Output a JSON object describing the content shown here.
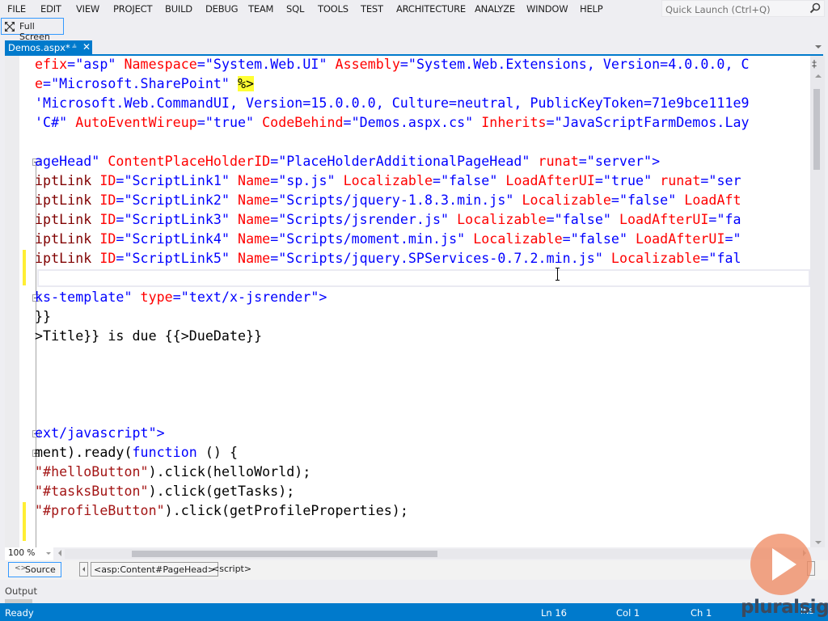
{
  "menubar": {
    "items": [
      "FILE",
      "EDIT",
      "VIEW",
      "PROJECT",
      "BUILD",
      "DEBUG",
      "TEAM",
      "SQL",
      "TOOLS",
      "TEST",
      "ARCHITECTURE",
      "ANALYZE",
      "WINDOW",
      "HELP"
    ],
    "quick_launch_placeholder": "Quick Launch (Ctrl+Q)",
    "search_icon": "search-icon"
  },
  "toolbar": {
    "full_screen_label": "Full Screen",
    "full_screen_icon": "fullscreen-icon"
  },
  "tabs": [
    {
      "label": "Demos.aspx*",
      "active": true,
      "pin_icon": "pin-icon",
      "close_icon": "close-icon"
    }
  ],
  "editor": {
    "current_line_number": 16,
    "lines": [
      [
        [
          "t-red",
          "efix"
        ],
        [
          "t-blue",
          "=\"asp\" "
        ],
        [
          "t-red",
          "Namespace"
        ],
        [
          "t-blue",
          "=\"System.Web.UI\" "
        ],
        [
          "t-red",
          "Assembly"
        ],
        [
          "t-blue",
          "=\"System.Web.Extensions, Version=4.0.0.0, C"
        ]
      ],
      [
        [
          "t-red",
          "e"
        ],
        [
          "t-blue",
          "=\"Microsoft.SharePoint\" "
        ],
        [
          "t-hl",
          "%>"
        ]
      ],
      [
        [
          "t-blue",
          "'Microsoft.Web.CommandUI, Version=15.0.0.0, Culture=neutral, PublicKeyToken=71e9bce111e9"
        ]
      ],
      [
        [
          "t-blue",
          "'C#\" "
        ],
        [
          "t-red",
          "AutoEventWireup"
        ],
        [
          "t-blue",
          "=\"true\" "
        ],
        [
          "t-red",
          "CodeBehind"
        ],
        [
          "t-blue",
          "=\"Demos.aspx.cs\" "
        ],
        [
          "t-red",
          "Inherits"
        ],
        [
          "t-blue",
          "=\"JavaScriptFarmDemos.Lay"
        ]
      ],
      [],
      [
        [
          "t-blue",
          "ageHead\" "
        ],
        [
          "t-red",
          "ContentPlaceHolderID"
        ],
        [
          "t-blue",
          "=\"PlaceHolderAdditionalPageHead\" "
        ],
        [
          "t-red",
          "runat"
        ],
        [
          "t-blue",
          "=\"server\">"
        ]
      ],
      [
        [
          "t-dark",
          "iptLink "
        ],
        [
          "t-red",
          "ID"
        ],
        [
          "t-blue",
          "=\"ScriptLink1\" "
        ],
        [
          "t-red",
          "Name"
        ],
        [
          "t-blue",
          "=\"sp.js\" "
        ],
        [
          "t-red",
          "Localizable"
        ],
        [
          "t-blue",
          "=\"false\" "
        ],
        [
          "t-red",
          "LoadAfterUI"
        ],
        [
          "t-blue",
          "=\"true\" "
        ],
        [
          "t-red",
          "runat"
        ],
        [
          "t-blue",
          "=\"ser"
        ]
      ],
      [
        [
          "t-dark",
          "iptLink "
        ],
        [
          "t-red",
          "ID"
        ],
        [
          "t-blue",
          "=\"ScriptLink2\" "
        ],
        [
          "t-red",
          "Name"
        ],
        [
          "t-blue",
          "=\"Scripts/jquery-1.8.3.min.js\" "
        ],
        [
          "t-red",
          "Localizable"
        ],
        [
          "t-blue",
          "=\"false\" "
        ],
        [
          "t-red",
          "LoadAft"
        ]
      ],
      [
        [
          "t-dark",
          "iptLink "
        ],
        [
          "t-red",
          "ID"
        ],
        [
          "t-blue",
          "=\"ScriptLink3\" "
        ],
        [
          "t-red",
          "Name"
        ],
        [
          "t-blue",
          "=\"Scripts/jsrender.js\" "
        ],
        [
          "t-red",
          "Localizable"
        ],
        [
          "t-blue",
          "=\"false\" "
        ],
        [
          "t-red",
          "LoadAfterUI"
        ],
        [
          "t-blue",
          "=\"fa"
        ]
      ],
      [
        [
          "t-dark",
          "iptLink "
        ],
        [
          "t-red",
          "ID"
        ],
        [
          "t-blue",
          "=\"ScriptLink4\" "
        ],
        [
          "t-red",
          "Name"
        ],
        [
          "t-blue",
          "=\"Scripts/moment.min.js\" "
        ],
        [
          "t-red",
          "Localizable"
        ],
        [
          "t-blue",
          "=\"false\" "
        ],
        [
          "t-red",
          "LoadAfterUI"
        ],
        [
          "t-blue",
          "=\""
        ]
      ],
      [
        [
          "t-dark",
          "iptLink "
        ],
        [
          "t-red",
          "ID"
        ],
        [
          "t-blue",
          "=\"ScriptLink5\" "
        ],
        [
          "t-red",
          "Name"
        ],
        [
          "t-blue",
          "=\"Scripts/jquery.SPServices-0.7.2.min.js\" "
        ],
        [
          "t-red",
          "Localizable"
        ],
        [
          "t-blue",
          "=\"fal"
        ]
      ],
      [],
      [
        [
          "t-blue",
          "ks-template\" "
        ],
        [
          "t-red",
          "type"
        ],
        [
          "t-blue",
          "=\"text/x-jsrender\">"
        ]
      ],
      [
        [
          "t-black",
          "}}"
        ]
      ],
      [
        [
          "t-black",
          ">Title}} is due {{>DueDate}}"
        ]
      ],
      [],
      [],
      [],
      [],
      [
        [
          "t-blue",
          "ext/javascript\">"
        ]
      ],
      [
        [
          "t-black",
          "ment).ready("
        ],
        [
          "t-blue",
          "function"
        ],
        [
          "t-black",
          " () {"
        ]
      ],
      [
        [
          "t-maroon",
          "\"#helloButton\""
        ],
        [
          "t-black",
          ").click(helloWorld);"
        ]
      ],
      [
        [
          "t-maroon",
          "\"#tasksButton\""
        ],
        [
          "t-black",
          ").click(getTasks);"
        ]
      ],
      [
        [
          "t-maroon",
          "\"#profileButton\""
        ],
        [
          "t-black",
          ").click(getProfileProperties);"
        ]
      ],
      []
    ]
  },
  "editor_footer": {
    "zoom_level": "100 %",
    "view_mode_label": "Source",
    "view_mode_icon": "source-code-icon",
    "breadcrumbs": [
      "<asp:Content#PageHead>",
      "<script>"
    ]
  },
  "output_panel": {
    "label": "Output"
  },
  "statusbar": {
    "status": "Ready",
    "line": "Ln 16",
    "column": "Col 1",
    "char": "Ch 1",
    "mode": "INS"
  },
  "watermark": {
    "brand": "pluralsight"
  }
}
